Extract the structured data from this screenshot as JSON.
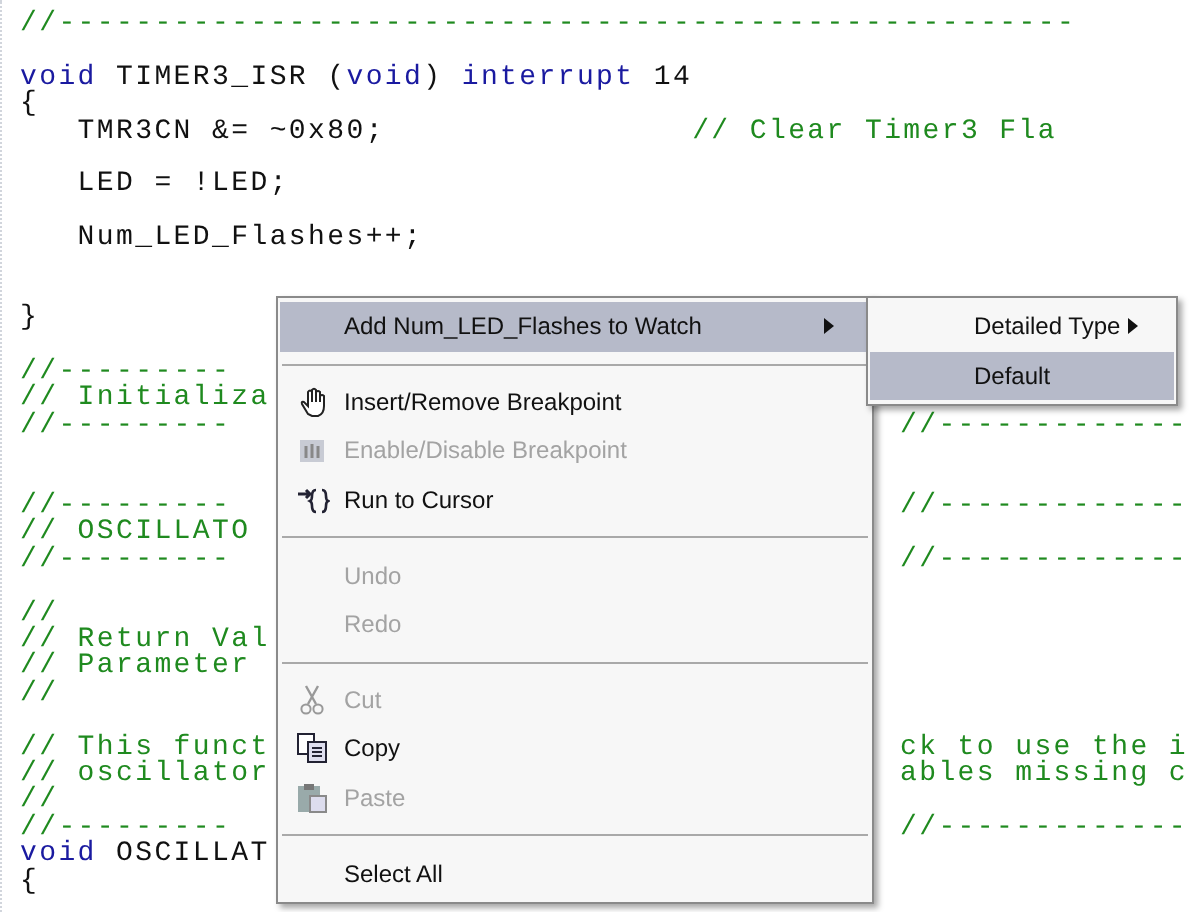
{
  "editor": {
    "lines": [
      {
        "kind": "code",
        "tokens": [
          {
            "kind": "comment",
            "text": "//-----------------------------------------------------"
          }
        ]
      },
      {
        "kind": "blank"
      },
      {
        "kind": "code",
        "tokens": [
          {
            "kind": "keyword",
            "text": "void"
          },
          {
            "kind": "plain",
            "text": " TIMER3_ISR ("
          },
          {
            "kind": "keyword",
            "text": "void"
          },
          {
            "kind": "plain",
            "text": ") "
          },
          {
            "kind": "keyword",
            "text": "interrupt"
          },
          {
            "kind": "plain",
            "text": " 14"
          }
        ]
      },
      {
        "kind": "code",
        "tokens": [
          {
            "kind": "plain",
            "text": "{"
          }
        ]
      },
      {
        "kind": "code",
        "tokens": [
          {
            "kind": "plain",
            "text": "   TMR3CN &= ~0x80;                "
          },
          {
            "kind": "comment",
            "text": "// Clear Timer3 Fla"
          }
        ]
      },
      {
        "kind": "blank"
      },
      {
        "kind": "code",
        "tokens": [
          {
            "kind": "plain",
            "text": "   LED = !LED;"
          }
        ]
      },
      {
        "kind": "blank"
      },
      {
        "kind": "code",
        "tokens": [
          {
            "kind": "plain",
            "text": "   Num_LED_Flashes++;"
          }
        ]
      },
      {
        "kind": "blank"
      },
      {
        "kind": "blank"
      },
      {
        "kind": "code",
        "tokens": [
          {
            "kind": "plain",
            "text": "}"
          }
        ]
      },
      {
        "kind": "blank"
      },
      {
        "kind": "code",
        "tokens": [
          {
            "kind": "comment",
            "text": "//---------"
          }
        ]
      },
      {
        "kind": "code",
        "tokens": [
          {
            "kind": "comment",
            "text": "// Initializa"
          }
        ]
      },
      {
        "kind": "code",
        "tokens": [
          {
            "kind": "comment",
            "text": "//---------"
          }
        ],
        "right": "//-------------"
      },
      {
        "kind": "blank"
      },
      {
        "kind": "blank"
      },
      {
        "kind": "code",
        "tokens": [
          {
            "kind": "comment",
            "text": "//---------"
          }
        ],
        "right": "//-------------"
      },
      {
        "kind": "code",
        "tokens": [
          {
            "kind": "comment",
            "text": "// OSCILLATO"
          }
        ]
      },
      {
        "kind": "code",
        "tokens": [
          {
            "kind": "comment",
            "text": "//---------"
          }
        ],
        "right": "//-------------"
      },
      {
        "kind": "blank"
      },
      {
        "kind": "code",
        "tokens": [
          {
            "kind": "comment",
            "text": "//"
          }
        ]
      },
      {
        "kind": "code",
        "tokens": [
          {
            "kind": "comment",
            "text": "// Return Val"
          }
        ]
      },
      {
        "kind": "code",
        "tokens": [
          {
            "kind": "comment",
            "text": "// Parameter"
          }
        ]
      },
      {
        "kind": "code",
        "tokens": [
          {
            "kind": "comment",
            "text": "//"
          }
        ]
      },
      {
        "kind": "blank"
      },
      {
        "kind": "code",
        "tokens": [
          {
            "kind": "comment",
            "text": "// This funct"
          }
        ],
        "right": "ck to use the i"
      },
      {
        "kind": "code",
        "tokens": [
          {
            "kind": "comment",
            "text": "// oscillator"
          }
        ],
        "right": "ables missing c"
      },
      {
        "kind": "code",
        "tokens": [
          {
            "kind": "comment",
            "text": "//"
          }
        ]
      },
      {
        "kind": "code",
        "tokens": [
          {
            "kind": "comment",
            "text": "//---------"
          }
        ],
        "right": "//-------------"
      },
      {
        "kind": "code",
        "tokens": [
          {
            "kind": "keyword",
            "text": "void"
          },
          {
            "kind": "plain",
            "text": " OSCILLAT"
          }
        ]
      },
      {
        "kind": "code",
        "tokens": [
          {
            "kind": "plain",
            "text": "{"
          }
        ]
      }
    ]
  },
  "context_menu": {
    "items": [
      {
        "kind": "item",
        "label": "Add Num_LED_Flashes to Watch",
        "disabled": false,
        "selected": true,
        "submenu": true
      },
      {
        "kind": "separator"
      },
      {
        "kind": "item",
        "label": "Insert/Remove Breakpoint",
        "disabled": false,
        "selected": false,
        "submenu": false
      },
      {
        "kind": "item",
        "label": "Enable/Disable Breakpoint",
        "disabled": true,
        "selected": false,
        "submenu": false
      },
      {
        "kind": "item",
        "label": "Run to Cursor",
        "disabled": false,
        "selected": false,
        "submenu": false
      },
      {
        "kind": "separator"
      },
      {
        "kind": "item",
        "label": "Undo",
        "disabled": true,
        "selected": false,
        "submenu": false
      },
      {
        "kind": "item",
        "label": "Redo",
        "disabled": true,
        "selected": false,
        "submenu": false
      },
      {
        "kind": "separator"
      },
      {
        "kind": "item",
        "label": "Cut",
        "disabled": true,
        "selected": false,
        "submenu": false
      },
      {
        "kind": "item",
        "label": "Copy",
        "disabled": false,
        "selected": false,
        "submenu": false
      },
      {
        "kind": "item",
        "label": "Paste",
        "disabled": true,
        "selected": false,
        "submenu": false
      },
      {
        "kind": "separator"
      },
      {
        "kind": "item",
        "label": "Select All",
        "disabled": false,
        "selected": false,
        "submenu": false
      }
    ]
  },
  "submenu": {
    "items": [
      {
        "kind": "item",
        "label": "Detailed Type",
        "disabled": false,
        "selected": false,
        "submenu": true
      },
      {
        "kind": "item",
        "label": "Default",
        "disabled": false,
        "selected": true,
        "submenu": false
      }
    ]
  }
}
